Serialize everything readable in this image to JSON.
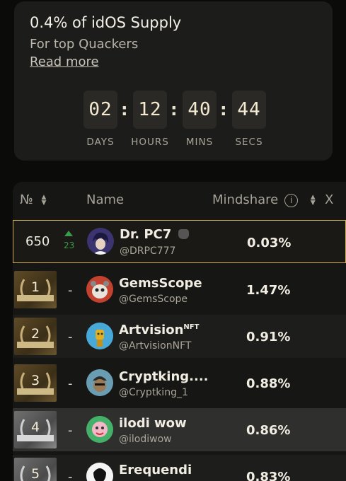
{
  "promo": {
    "title": "0.4% of idOS Supply",
    "subtitle": "For top Quackers",
    "link": "Read more"
  },
  "countdown": [
    {
      "value": "02",
      "label": "DAYS"
    },
    {
      "value": "12",
      "label": "HOURS"
    },
    {
      "value": "40",
      "label": "MINS"
    },
    {
      "value": "44",
      "label": "SECS"
    }
  ],
  "table": {
    "headers": {
      "rank": "№",
      "name": "Name",
      "mindshare": "Mindshare",
      "extra": "X"
    },
    "current_user": {
      "rank": "650",
      "change": "23",
      "name": "Dr. PC7",
      "handle": "@DRPC777",
      "mindshare": "0.03%"
    },
    "rows": [
      {
        "rank": "1",
        "change": "-",
        "name": "GemsScope",
        "handle": "@GemsScope",
        "mindshare": "1.47%"
      },
      {
        "rank": "2",
        "change": "-",
        "name": "Artvision",
        "name_sup": "NFT",
        "handle": "@ArtvisionNFT",
        "mindshare": "0.91%"
      },
      {
        "rank": "3",
        "change": "-",
        "name": "Cryptking....",
        "handle": "@Cryptking_1",
        "mindshare": "0.88%"
      },
      {
        "rank": "4",
        "change": "-",
        "name": "ilodi wow",
        "handle": "@ilodiwow",
        "mindshare": "0.86%"
      },
      {
        "rank": "5",
        "change": "-",
        "name": "Erequendi",
        "handle": "",
        "mindshare": "0.83%"
      }
    ]
  },
  "colors": {
    "accent_gold": "#cfae55",
    "up_green": "#3a9a4a"
  }
}
